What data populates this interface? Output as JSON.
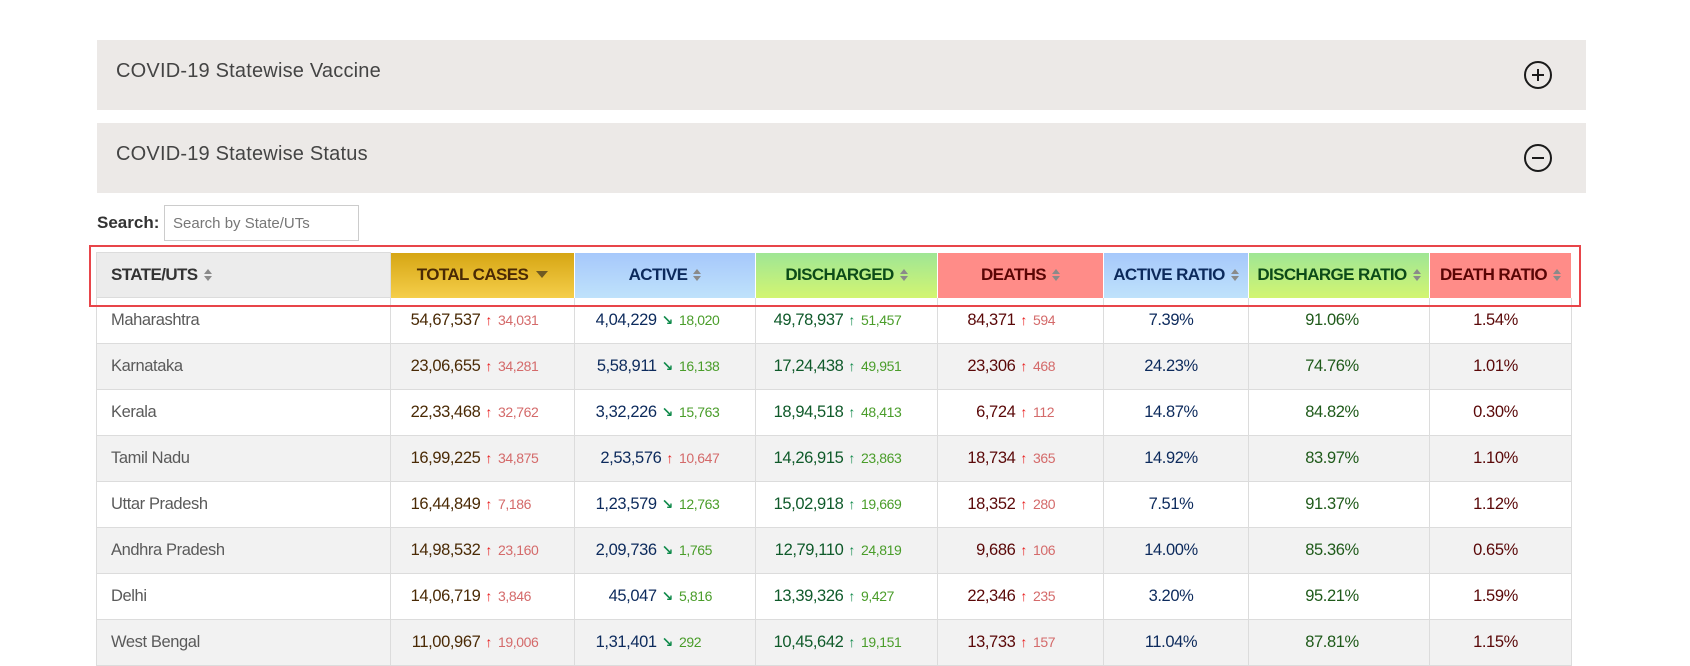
{
  "panels": [
    {
      "title": "COVID-19 Statewise Vaccine",
      "icon": "plus-circle-icon",
      "expanded": false
    },
    {
      "title": "COVID-19 Statewise Status",
      "icon": "minus-circle-icon",
      "expanded": true
    }
  ],
  "search": {
    "label": "Search:",
    "placeholder": "Search by State/UTs",
    "value": ""
  },
  "table": {
    "columns": [
      {
        "key": "state",
        "label": "STATE/UTS",
        "sort": "none"
      },
      {
        "key": "total",
        "label": "TOTAL CASES",
        "sort": "desc"
      },
      {
        "key": "active",
        "label": "ACTIVE",
        "sort": "none"
      },
      {
        "key": "discharged",
        "label": "DISCHARGED",
        "sort": "none"
      },
      {
        "key": "deaths",
        "label": "DEATHS",
        "sort": "none"
      },
      {
        "key": "active_ratio",
        "label": "ACTIVE RATIO",
        "sort": "none"
      },
      {
        "key": "discharge_ratio",
        "label": "DISCHARGE RATIO",
        "sort": "none"
      },
      {
        "key": "death_ratio",
        "label": "DEATH RATIO",
        "sort": "none"
      }
    ],
    "rows": [
      {
        "state": "Maharashtra",
        "total": "54,67,537",
        "total_delta": "34,031",
        "total_dir": "up",
        "active": "4,04,229",
        "active_delta": "18,020",
        "active_dir": "down",
        "discharged": "49,78,937",
        "discharged_delta": "51,457",
        "discharged_dir": "up",
        "deaths": "84,371",
        "deaths_delta": "594",
        "deaths_dir": "up",
        "active_ratio": "7.39%",
        "discharge_ratio": "91.06%",
        "death_ratio": "1.54%"
      },
      {
        "state": "Karnataka",
        "total": "23,06,655",
        "total_delta": "34,281",
        "total_dir": "up",
        "active": "5,58,911",
        "active_delta": "16,138",
        "active_dir": "down",
        "discharged": "17,24,438",
        "discharged_delta": "49,951",
        "discharged_dir": "up",
        "deaths": "23,306",
        "deaths_delta": "468",
        "deaths_dir": "up",
        "active_ratio": "24.23%",
        "discharge_ratio": "74.76%",
        "death_ratio": "1.01%"
      },
      {
        "state": "Kerala",
        "total": "22,33,468",
        "total_delta": "32,762",
        "total_dir": "up",
        "active": "3,32,226",
        "active_delta": "15,763",
        "active_dir": "down",
        "discharged": "18,94,518",
        "discharged_delta": "48,413",
        "discharged_dir": "up",
        "deaths": "6,724",
        "deaths_delta": "112",
        "deaths_dir": "up",
        "active_ratio": "14.87%",
        "discharge_ratio": "84.82%",
        "death_ratio": "0.30%"
      },
      {
        "state": "Tamil Nadu",
        "total": "16,99,225",
        "total_delta": "34,875",
        "total_dir": "up",
        "active": "2,53,576",
        "active_delta": "10,647",
        "active_dir": "up",
        "discharged": "14,26,915",
        "discharged_delta": "23,863",
        "discharged_dir": "up",
        "deaths": "18,734",
        "deaths_delta": "365",
        "deaths_dir": "up",
        "active_ratio": "14.92%",
        "discharge_ratio": "83.97%",
        "death_ratio": "1.10%"
      },
      {
        "state": "Uttar Pradesh",
        "total": "16,44,849",
        "total_delta": "7,186",
        "total_dir": "up",
        "active": "1,23,579",
        "active_delta": "12,763",
        "active_dir": "down",
        "discharged": "15,02,918",
        "discharged_delta": "19,669",
        "discharged_dir": "up",
        "deaths": "18,352",
        "deaths_delta": "280",
        "deaths_dir": "up",
        "active_ratio": "7.51%",
        "discharge_ratio": "91.37%",
        "death_ratio": "1.12%"
      },
      {
        "state": "Andhra Pradesh",
        "total": "14,98,532",
        "total_delta": "23,160",
        "total_dir": "up",
        "active": "2,09,736",
        "active_delta": "1,765",
        "active_dir": "down",
        "discharged": "12,79,110",
        "discharged_delta": "24,819",
        "discharged_dir": "up",
        "deaths": "9,686",
        "deaths_delta": "106",
        "deaths_dir": "up",
        "active_ratio": "14.00%",
        "discharge_ratio": "85.36%",
        "death_ratio": "0.65%"
      },
      {
        "state": "Delhi",
        "total": "14,06,719",
        "total_delta": "3,846",
        "total_dir": "up",
        "active": "45,047",
        "active_delta": "5,816",
        "active_dir": "down",
        "discharged": "13,39,326",
        "discharged_delta": "9,427",
        "discharged_dir": "up",
        "deaths": "22,346",
        "deaths_delta": "235",
        "deaths_dir": "up",
        "active_ratio": "3.20%",
        "discharge_ratio": "95.21%",
        "death_ratio": "1.59%"
      },
      {
        "state": "West Bengal",
        "total": "11,00,967",
        "total_delta": "19,006",
        "total_dir": "up",
        "active": "1,31,401",
        "active_delta": "292",
        "active_dir": "down",
        "discharged": "10,45,642",
        "discharged_delta": "19,151",
        "discharged_dir": "up",
        "deaths": "13,733",
        "deaths_delta": "157",
        "deaths_dir": "up",
        "active_ratio": "11.04%",
        "discharge_ratio": "87.81%",
        "death_ratio": "1.15%"
      }
    ]
  },
  "colors": {
    "total_header": "#e5b82c",
    "active_header": "#b3d5fb",
    "discharged_header": "#b9ee83",
    "deaths_header": "#ff8c88",
    "increase_red": "#e81c1c",
    "decrease_green": "#0f8a4a",
    "highlight_border": "#e8454a"
  }
}
